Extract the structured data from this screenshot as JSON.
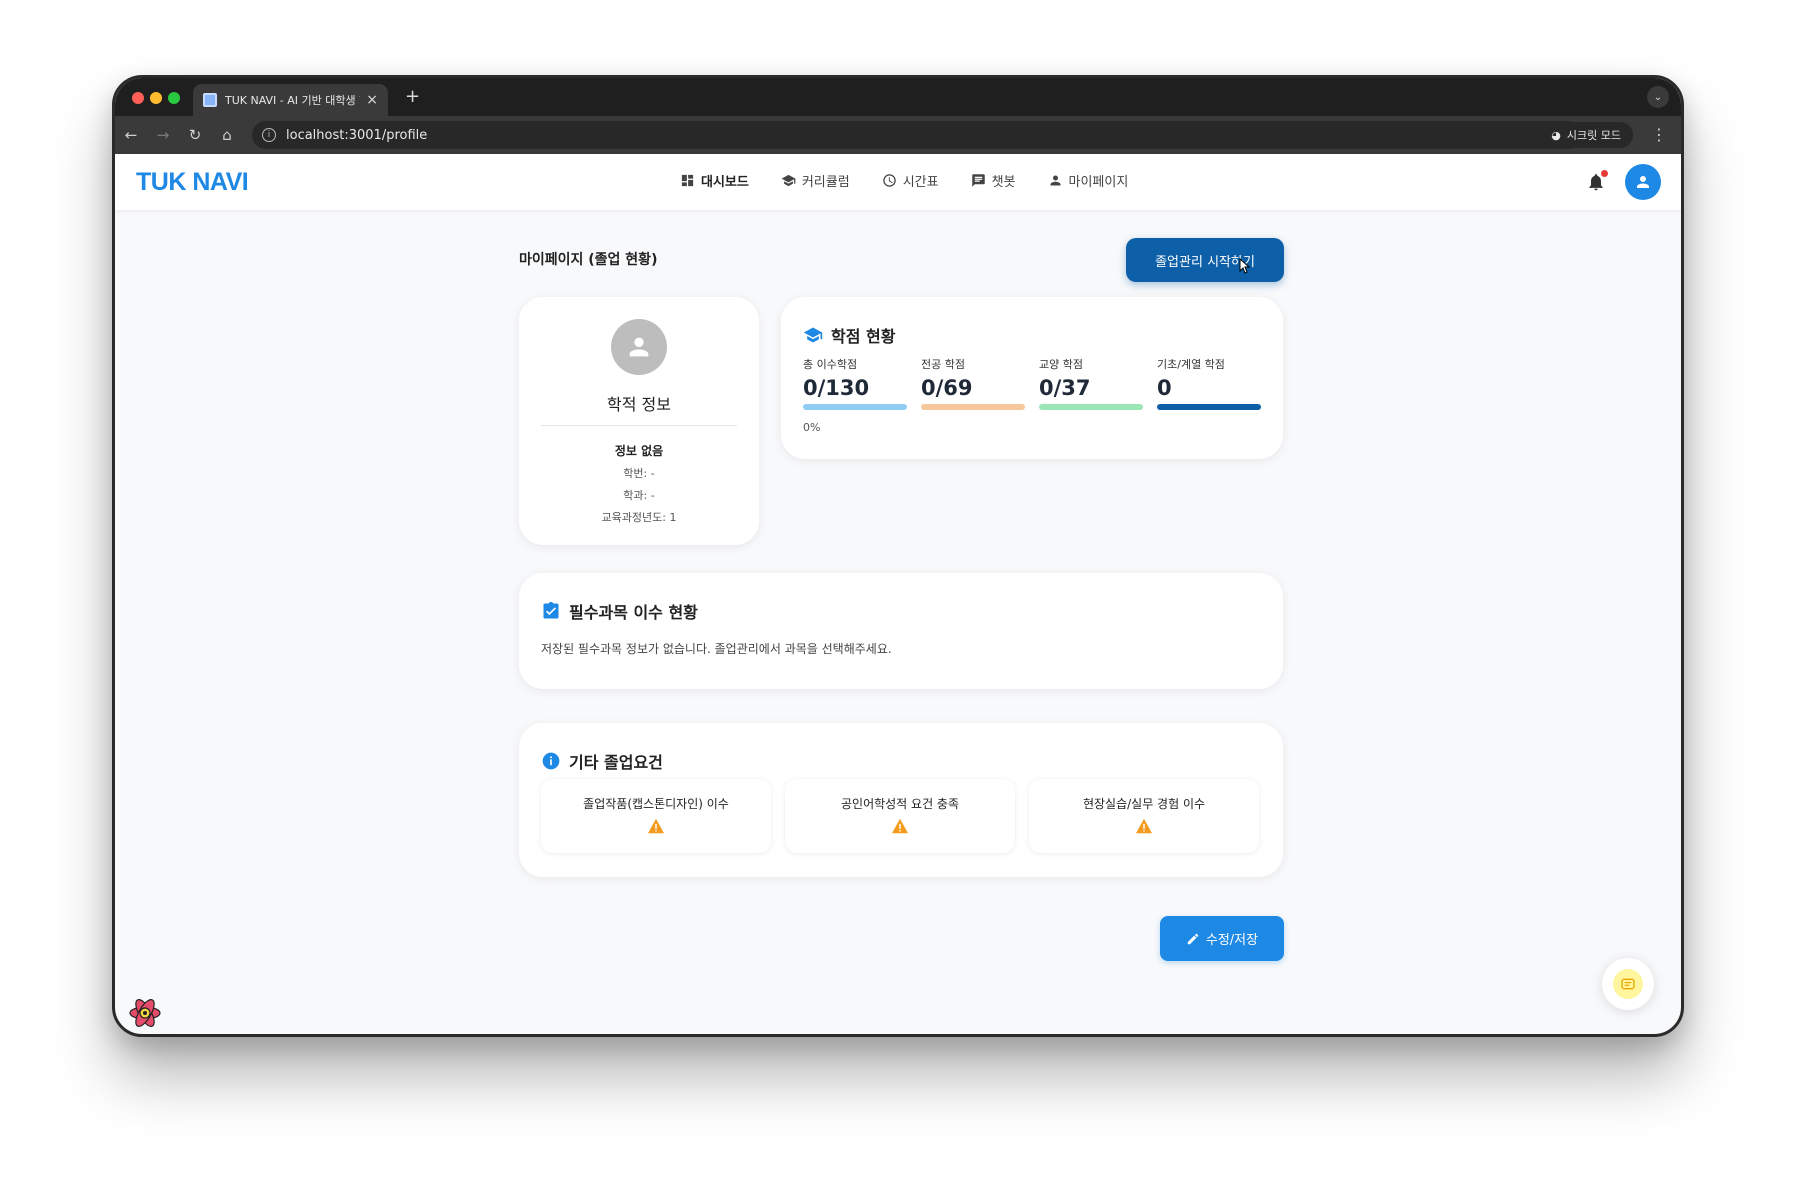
{
  "browser": {
    "tab_title": "TUK NAVI - AI 기반 대학생 학습",
    "url": "localhost:3001/profile",
    "incognito_label": "시크릿 모드"
  },
  "app": {
    "brand": "TUK NAVI",
    "nav": [
      {
        "label": "대시보드",
        "icon": "dashboard-icon"
      },
      {
        "label": "커리큘럼",
        "icon": "graduation-cap-icon"
      },
      {
        "label": "시간표",
        "icon": "clock-icon"
      },
      {
        "label": "챗봇",
        "icon": "chat-icon"
      },
      {
        "label": "마이페이지",
        "icon": "person-icon"
      }
    ],
    "accent": "#1e88e5"
  },
  "page": {
    "title": "마이페이지 (졸업 현황)",
    "start_button": "졸업관리 시작하기",
    "edit_button": "수정/저장"
  },
  "profile": {
    "heading": "학적 정보",
    "name": "정보 없음",
    "student_id": "학번: -",
    "department": "학과: -",
    "curriculum_year": "교육과정년도: 1"
  },
  "credits": {
    "title": "학점 현황",
    "items": [
      {
        "label": "총 이수학점",
        "value": "0/130",
        "color": "#90cdf4"
      },
      {
        "label": "전공 학점",
        "value": "0/69",
        "color": "#f6c79a"
      },
      {
        "label": "교양 학점",
        "value": "0/37",
        "color": "#9ae6b4"
      },
      {
        "label": "기초/계열 학점",
        "value": "0",
        "color": "#0d5fa8"
      }
    ],
    "percent": "0%"
  },
  "required_courses": {
    "title": "필수과목 이수 현황",
    "message": "저장된 필수과목 정보가 없습니다. 졸업관리에서 과목을 선택해주세요."
  },
  "other_requirements": {
    "title": "기타 졸업요건",
    "items": [
      {
        "label": "졸업작품(캡스톤디자인) 이수",
        "status_icon": "warning-icon"
      },
      {
        "label": "공인어학성적 요건 충족",
        "status_icon": "warning-icon"
      },
      {
        "label": "현장실습/실무 경험 이수",
        "status_icon": "warning-icon"
      }
    ]
  }
}
